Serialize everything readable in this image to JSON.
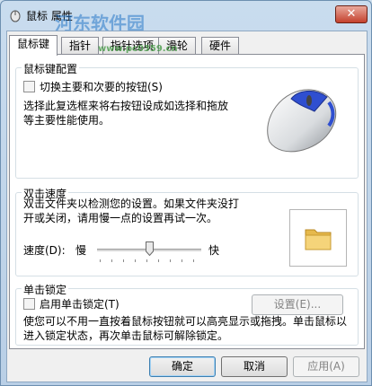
{
  "window": {
    "title": "鼠标 属性",
    "close_glyph": "✕"
  },
  "watermark": {
    "text": "河东软件园",
    "url": "www.pc0359.cn"
  },
  "tabs": [
    {
      "label": "鼠标键",
      "active": true
    },
    {
      "label": "指针",
      "active": false
    },
    {
      "label": "指针选项",
      "active": false
    },
    {
      "label": "滑轮",
      "active": false
    },
    {
      "label": "硬件",
      "active": false
    }
  ],
  "buttons_config": {
    "title": "鼠标键配置",
    "switch_label": "切换主要和次要的按钮(S)",
    "description": "选择此复选框来将右按钮设成如选择和拖放等主要性能使用。",
    "checked": false
  },
  "double_click": {
    "title": "双击速度",
    "description": "双击文件夹以检测您的设置。如果文件夹没打开或关闭，请用慢一点的设置再试一次。",
    "speed_label": "速度(D):",
    "slow_label": "慢",
    "fast_label": "快",
    "speed_fraction": 0.5
  },
  "click_lock": {
    "title": "单击锁定",
    "enable_label": "启用单击锁定(T)",
    "settings_label": "设置(E)...",
    "description": "使您可以不用一直按着鼠标按钮就可以高亮显示或拖拽。单击鼠标以进入锁定状态，再次单击鼠标可解除锁定。",
    "checked": false
  },
  "footer": {
    "ok": "确定",
    "cancel": "取消",
    "apply": "应用(A)"
  },
  "colors": {
    "title_bg": "#c9dcee",
    "close_red": "#c4412d",
    "accent_blue": "#3c7fb1"
  }
}
